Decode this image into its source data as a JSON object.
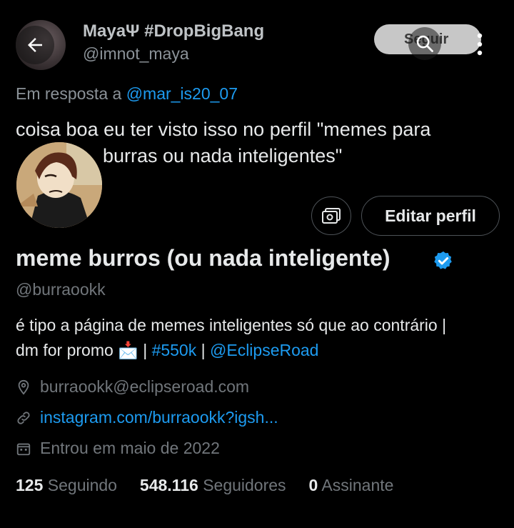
{
  "reply_context": {
    "author_name": "MayaΨ #DropBigBang",
    "author_handle": "@imnot_maya",
    "follow_label": "Seguir",
    "reply_prefix": "Em resposta a",
    "reply_mention": "@mar_is20_07",
    "tweet_line1": "coisa boa eu ter visto isso no perfil \"memes para",
    "tweet_line2": "burras ou nada inteligentes\""
  },
  "profile": {
    "name": "meme burros (ou nada inteligente)",
    "handle": "@burraookk",
    "edit_button": "Editar perfil",
    "bio_line1": "é tipo a página de memes inteligentes só que ao contrário |",
    "bio_line2_text": "dm for promo",
    "bio_emoji": "📩",
    "bio_hashtag": "#550k",
    "bio_mention": "@EclipseRoad",
    "bio_separator": "|",
    "location": "burraookk@eclipseroad.com",
    "website": "instagram.com/burraookk?igsh...",
    "joined": "Entrou em maio de 2022"
  },
  "stats": {
    "following_count": "125",
    "following_label": "Seguindo",
    "followers_count": "548.116",
    "followers_label": "Seguidores",
    "subscribers_count": "0",
    "subscribers_label": "Assinante"
  },
  "icons": {
    "back": "arrow-left-icon",
    "search": "search-icon",
    "more": "more-vertical-icon",
    "photos": "photo-gallery-icon",
    "verified": "verified-badge-icon",
    "location": "location-pin-icon",
    "link": "link-icon",
    "calendar": "calendar-icon"
  },
  "colors": {
    "background": "#000000",
    "accent": "#1d9bf0",
    "text": "#e7e9ea",
    "muted": "#71767b"
  }
}
